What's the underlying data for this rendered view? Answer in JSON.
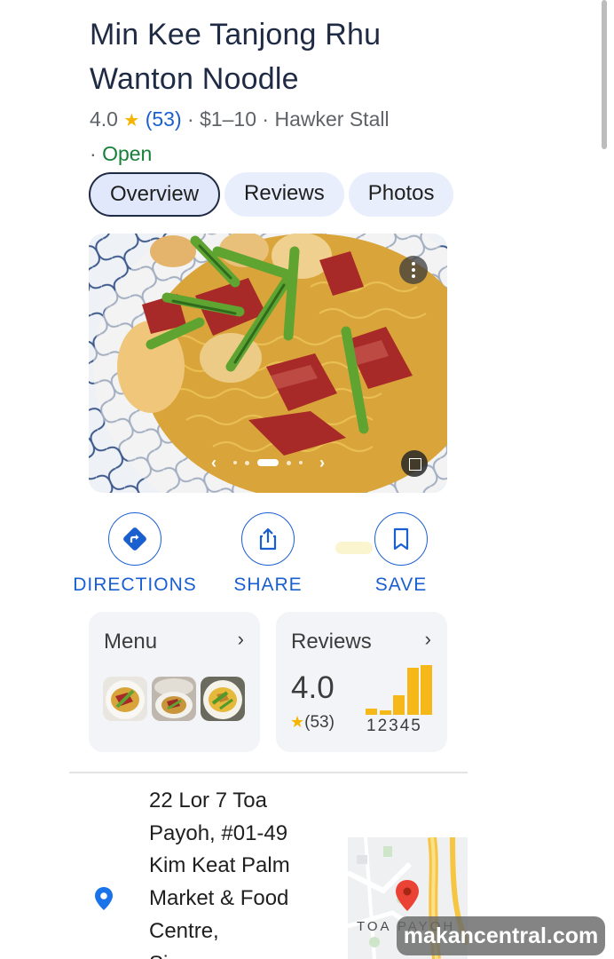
{
  "place": {
    "name_line1": "Min Kee Tanjong Rhu",
    "name_line2": "Wanton Noodle",
    "rating": "4.0",
    "review_count": "(53)",
    "price": "$1–10",
    "category": "Hawker Stall",
    "status": "Open",
    "star_color": "#f4b400",
    "status_color": "#188038"
  },
  "tabs": [
    {
      "label": "Overview",
      "active": true
    },
    {
      "label": "Reviews",
      "active": false
    },
    {
      "label": "Photos",
      "active": false
    }
  ],
  "photo": {
    "prev_icon": "chevron-left-icon",
    "next_icon": "chevron-right-icon",
    "menu_icon": "more-vertical-icon",
    "expand_icon": "expand-square-icon",
    "current_index": 3,
    "page_count": 5
  },
  "actions": [
    {
      "label": "DIRECTIONS",
      "icon": "directions-icon"
    },
    {
      "label": "SHARE",
      "icon": "share-icon"
    },
    {
      "label": "SAVE",
      "icon": "bookmark-icon"
    }
  ],
  "menu_card": {
    "title": "Menu",
    "chevron": "›"
  },
  "reviews_card": {
    "title": "Reviews",
    "chevron": "›",
    "rating": "4.0",
    "star": "★",
    "count": "(53)",
    "distribution_labels": "12345",
    "distribution": [
      {
        "stars": 1,
        "share": 0.12
      },
      {
        "stars": 2,
        "share": 0.08
      },
      {
        "stars": 3,
        "share": 0.38
      },
      {
        "stars": 4,
        "share": 0.92
      },
      {
        "stars": 5,
        "share": 0.97
      }
    ]
  },
  "address": {
    "icon": "location-pin-icon",
    "lines": [
      "22 Lor 7 Toa",
      "Payoh, #01-49",
      "Kim Keat Palm",
      "Market & Food",
      "Centre,",
      "Singapore"
    ]
  },
  "map": {
    "label": "TOA PAYOH",
    "marker_color": "#ea4335"
  },
  "watermark": "makancentral.com",
  "accent_color": "#1a5fd0"
}
